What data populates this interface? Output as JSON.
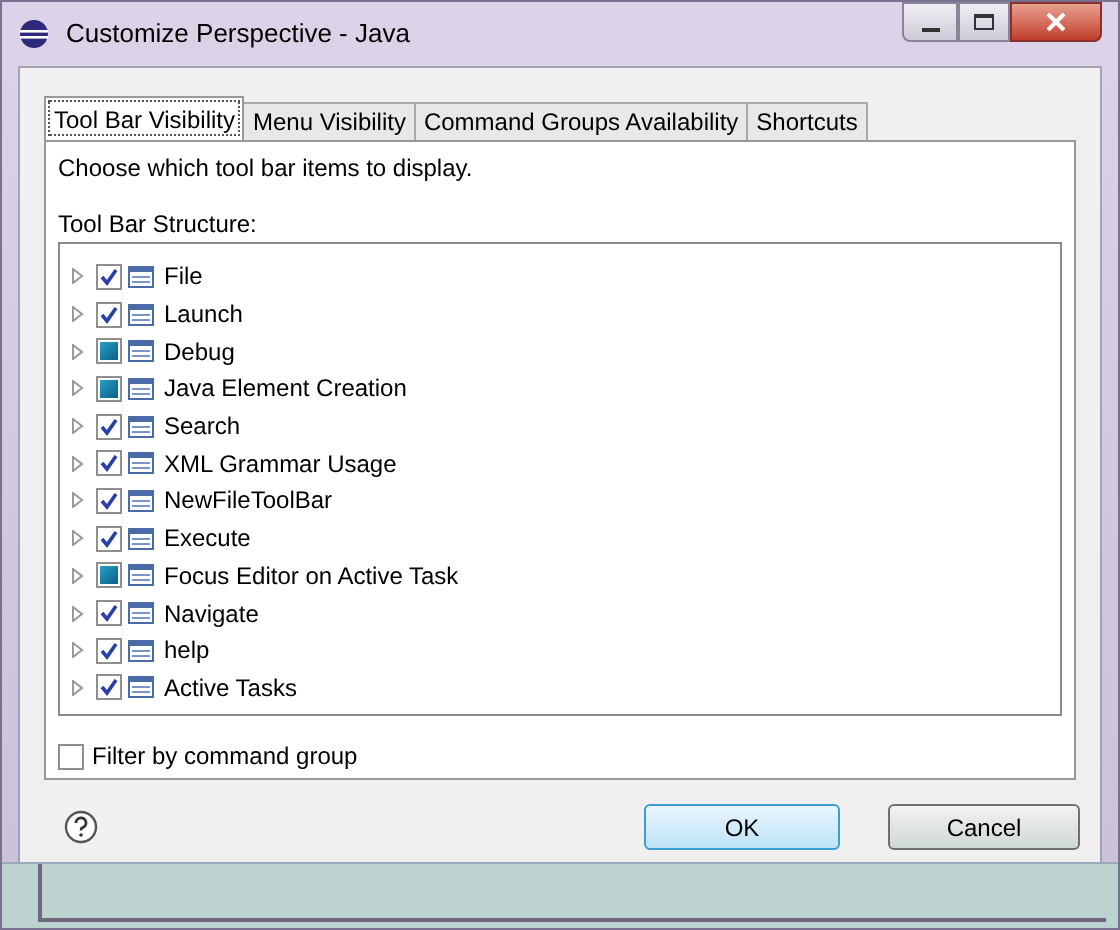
{
  "window": {
    "title": "Customize Perspective - Java"
  },
  "tabs": [
    {
      "label": "Tool Bar Visibility",
      "selected": true
    },
    {
      "label": "Menu Visibility",
      "selected": false
    },
    {
      "label": "Command Groups Availability",
      "selected": false
    },
    {
      "label": "Shortcuts",
      "selected": false
    }
  ],
  "instruction": "Choose which tool bar items to display.",
  "tree": {
    "label": "Tool Bar Structure:",
    "items": [
      {
        "label": "File",
        "checked": true,
        "partial": false
      },
      {
        "label": "Launch",
        "checked": true,
        "partial": false
      },
      {
        "label": "Debug",
        "checked": false,
        "partial": true
      },
      {
        "label": "Java Element Creation",
        "checked": false,
        "partial": true
      },
      {
        "label": "Search",
        "checked": true,
        "partial": false
      },
      {
        "label": "XML Grammar Usage",
        "checked": true,
        "partial": false
      },
      {
        "label": "NewFileToolBar",
        "checked": true,
        "partial": false
      },
      {
        "label": "Execute",
        "checked": true,
        "partial": false
      },
      {
        "label": "Focus Editor on Active Task",
        "checked": false,
        "partial": true
      },
      {
        "label": "Navigate",
        "checked": true,
        "partial": false
      },
      {
        "label": "help",
        "checked": true,
        "partial": false
      },
      {
        "label": "Active Tasks",
        "checked": true,
        "partial": false
      }
    ]
  },
  "filter": {
    "label": "Filter by command group",
    "checked": false
  },
  "buttons": [
    "OK",
    "Cancel"
  ]
}
